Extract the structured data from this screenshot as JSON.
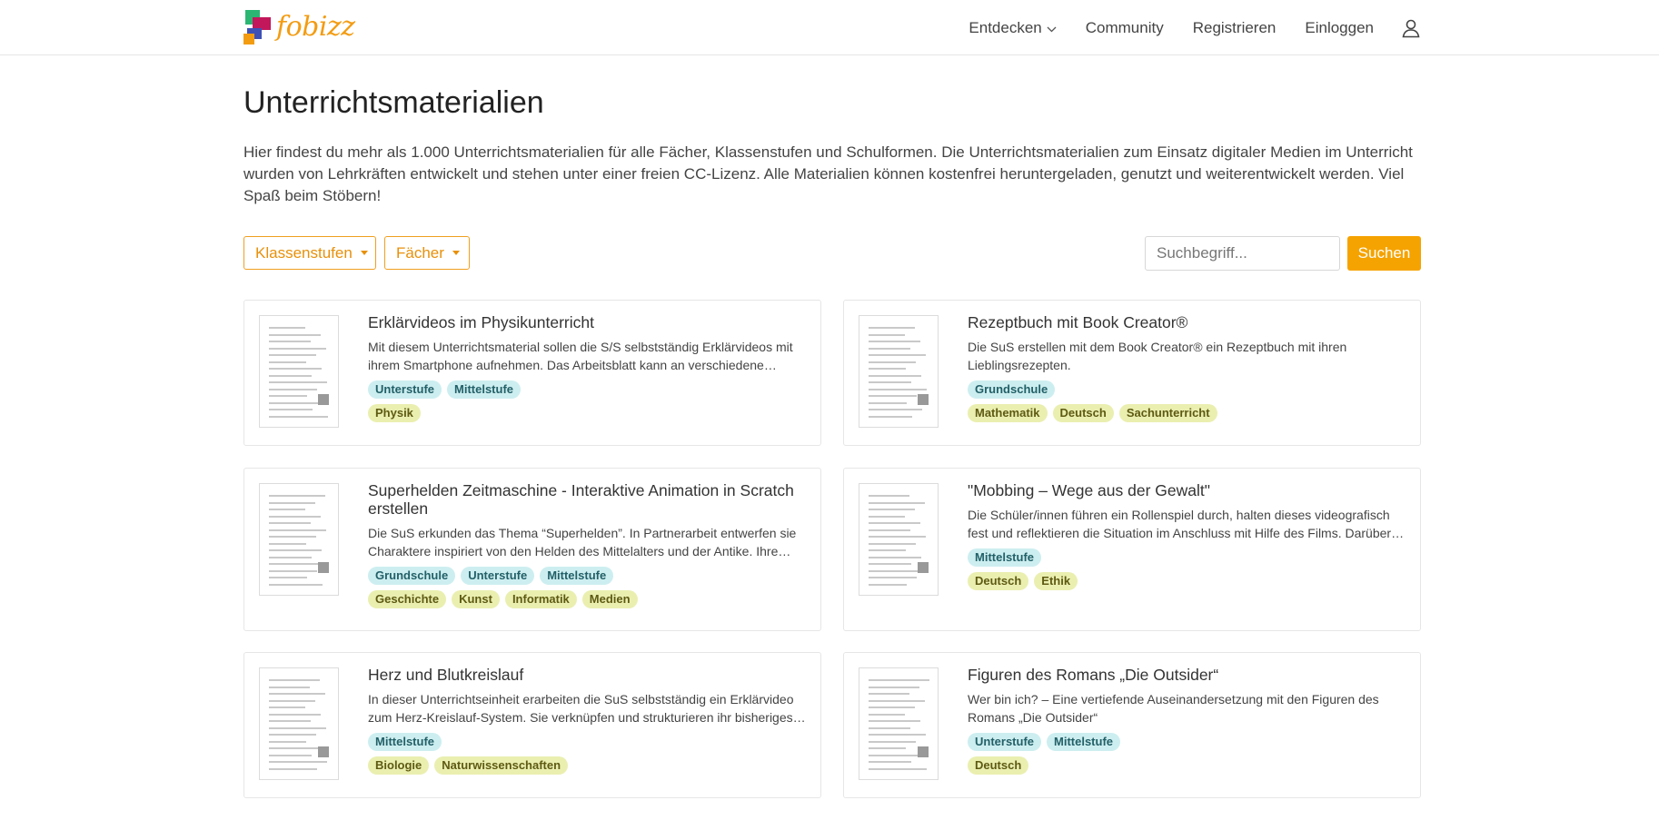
{
  "header": {
    "logo_text": "fobizz",
    "nav": [
      "Entdecken",
      "Community",
      "Registrieren",
      "Einloggen"
    ]
  },
  "page": {
    "title": "Unterrichtsmaterialien",
    "intro": "Hier findest du mehr als 1.000 Unterrichtsmaterialien für alle Fächer, Klassenstufen und Schulformen. Die Unterrichtsmaterialien zum Einsatz digitaler Medien im Unterricht wurden von Lehrkräften entwickelt und stehen unter einer freien CC-Lizenz. Alle Materialien können kostenfrei heruntergeladen, genutzt und weiterentwickelt werden. Viel Spaß beim Stöbern!"
  },
  "filters": {
    "grades_label": "Klassenstufen",
    "subjects_label": "Fächer",
    "search_placeholder": "Suchbegriff...",
    "search_button": "Suchen"
  },
  "colors": {
    "accent": "#f5a300",
    "level_tag_bg": "#cdeef0",
    "subject_tag_bg": "#eaefb0"
  },
  "cards": [
    {
      "title": "Erklärvideos im Physikunterricht",
      "desc": "Mit diesem Unterrichtsmaterial sollen die S/S selbstständig Erklärvideos mit ihrem Smartphone aufnehmen. Das Arbeitsblatt kann an verschiedene Themen angepasst werden.",
      "levels": [
        "Unterstufe",
        "Mittelstufe"
      ],
      "subjects": [
        "Physik"
      ]
    },
    {
      "title": "Rezeptbuch mit Book Creator®",
      "desc": "Die SuS erstellen mit dem Book Creator® ein Rezeptbuch mit ihren Lieblingsrezepten.",
      "levels": [
        "Grundschule"
      ],
      "subjects": [
        "Mathematik",
        "Deutsch",
        "Sachunterricht"
      ]
    },
    {
      "title": "Superhelden Zeitmaschine - Interaktive Animation in Scratch erstellen",
      "desc": "Die SuS erkunden das Thema “Superhelden”. In Partnerarbeit entwerfen sie Charaktere inspiriert von den Helden des Mittelalters und der Antike. Ihre Ergebnisse setzen sie in Scratch um.",
      "levels": [
        "Grundschule",
        "Unterstufe",
        "Mittelstufe"
      ],
      "subjects": [
        "Geschichte",
        "Kunst",
        "Informatik",
        "Medien"
      ]
    },
    {
      "title": "\"Mobbing – Wege aus der Gewalt\"",
      "desc": "Die Schüler/innen führen ein Rollenspiel durch, halten dieses videografisch fest und reflektieren die Situation im Anschluss mit Hilfe des Films. Darüber hinaus erarbeiten sie Lösungswege.",
      "levels": [
        "Mittelstufe"
      ],
      "subjects": [
        "Deutsch",
        "Ethik"
      ]
    },
    {
      "title": "Herz und Blutkreislauf",
      "desc": "In dieser Unterrichtseinheit erarbeiten die SuS selbstständig ein Erklärvideo zum Herz-Kreislauf-System. Sie verknüpfen und strukturieren ihr bisheriges Wissen dazu.",
      "levels": [
        "Mittelstufe"
      ],
      "subjects": [
        "Biologie",
        "Naturwissenschaften"
      ]
    },
    {
      "title": "Figuren des Romans „Die Outsider“",
      "desc": "Wer bin ich? – Eine vertiefende Auseinandersetzung mit den Figuren des Romans „Die Outsider“",
      "levels": [
        "Unterstufe",
        "Mittelstufe"
      ],
      "subjects": [
        "Deutsch"
      ]
    }
  ]
}
